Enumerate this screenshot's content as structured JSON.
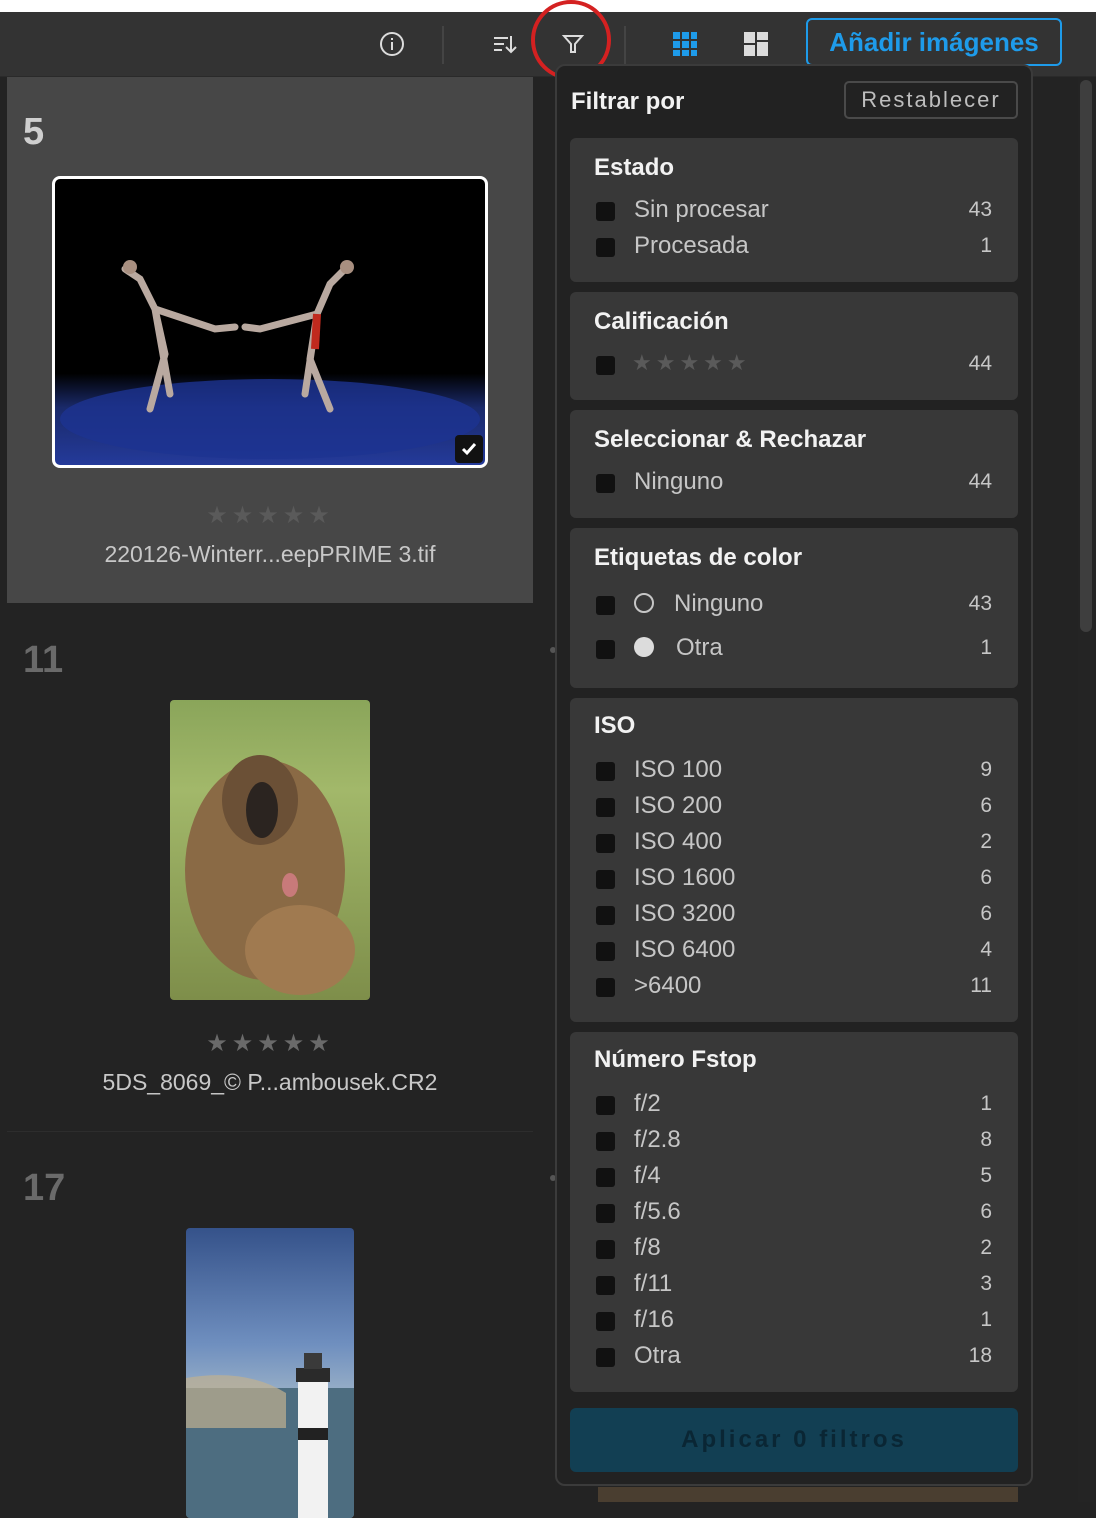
{
  "toolbar": {
    "info_icon": "info-icon",
    "sort_icon": "sort-icon",
    "filter_icon": "filter-icon",
    "grid_icon": "grid-view-icon",
    "mosaic_icon": "mosaic-view-icon",
    "add_images_label": "Añadir imágenes",
    "accent_color": "#1e9bea"
  },
  "grid": {
    "cells": [
      {
        "number": "5",
        "rating": "★★★★★",
        "filename": "220126-Winterr...eepPRIME 3.tif",
        "selected": true
      },
      {
        "number": "11",
        "rating": "★★★★★",
        "filename": "5DS_8069_© P...ambousek.CR2",
        "selected": false
      },
      {
        "number": "17",
        "rating": "",
        "filename": "",
        "selected": false
      }
    ]
  },
  "filter_panel": {
    "title": "Filtrar por",
    "reset_label": "Restablecer",
    "sections": {
      "estado": {
        "title": "Estado",
        "items": [
          {
            "label": "Sin procesar",
            "count": "43"
          },
          {
            "label": "Procesada",
            "count": "1"
          }
        ]
      },
      "calificacion": {
        "title": "Calificación",
        "items": [
          {
            "stars": "★★★★★",
            "count": "44"
          }
        ]
      },
      "seleccionar": {
        "title": "Seleccionar & Rechazar",
        "items": [
          {
            "label": "Ninguno",
            "count": "44"
          }
        ]
      },
      "etiquetas": {
        "title": "Etiquetas de color",
        "items": [
          {
            "label": "Ninguno",
            "count": "43"
          },
          {
            "label": "Otra",
            "count": "1"
          }
        ]
      },
      "iso": {
        "title": "ISO",
        "items": [
          {
            "label": "ISO 100",
            "count": "9"
          },
          {
            "label": "ISO 200",
            "count": "6"
          },
          {
            "label": "ISO 400",
            "count": "2"
          },
          {
            "label": "ISO 1600",
            "count": "6"
          },
          {
            "label": "ISO 3200",
            "count": "6"
          },
          {
            "label": "ISO 6400",
            "count": "4"
          },
          {
            "label": ">6400",
            "count": "11"
          }
        ]
      },
      "fstop": {
        "title": "Número Fstop",
        "items": [
          {
            "label": "f/2",
            "count": "1"
          },
          {
            "label": "f/2.8",
            "count": "8"
          },
          {
            "label": "f/4",
            "count": "5"
          },
          {
            "label": "f/5.6",
            "count": "6"
          },
          {
            "label": "f/8",
            "count": "2"
          },
          {
            "label": "f/11",
            "count": "3"
          },
          {
            "label": "f/16",
            "count": "1"
          },
          {
            "label": "Otra",
            "count": "18"
          }
        ]
      }
    },
    "apply_label": "Aplicar 0 filtros"
  }
}
